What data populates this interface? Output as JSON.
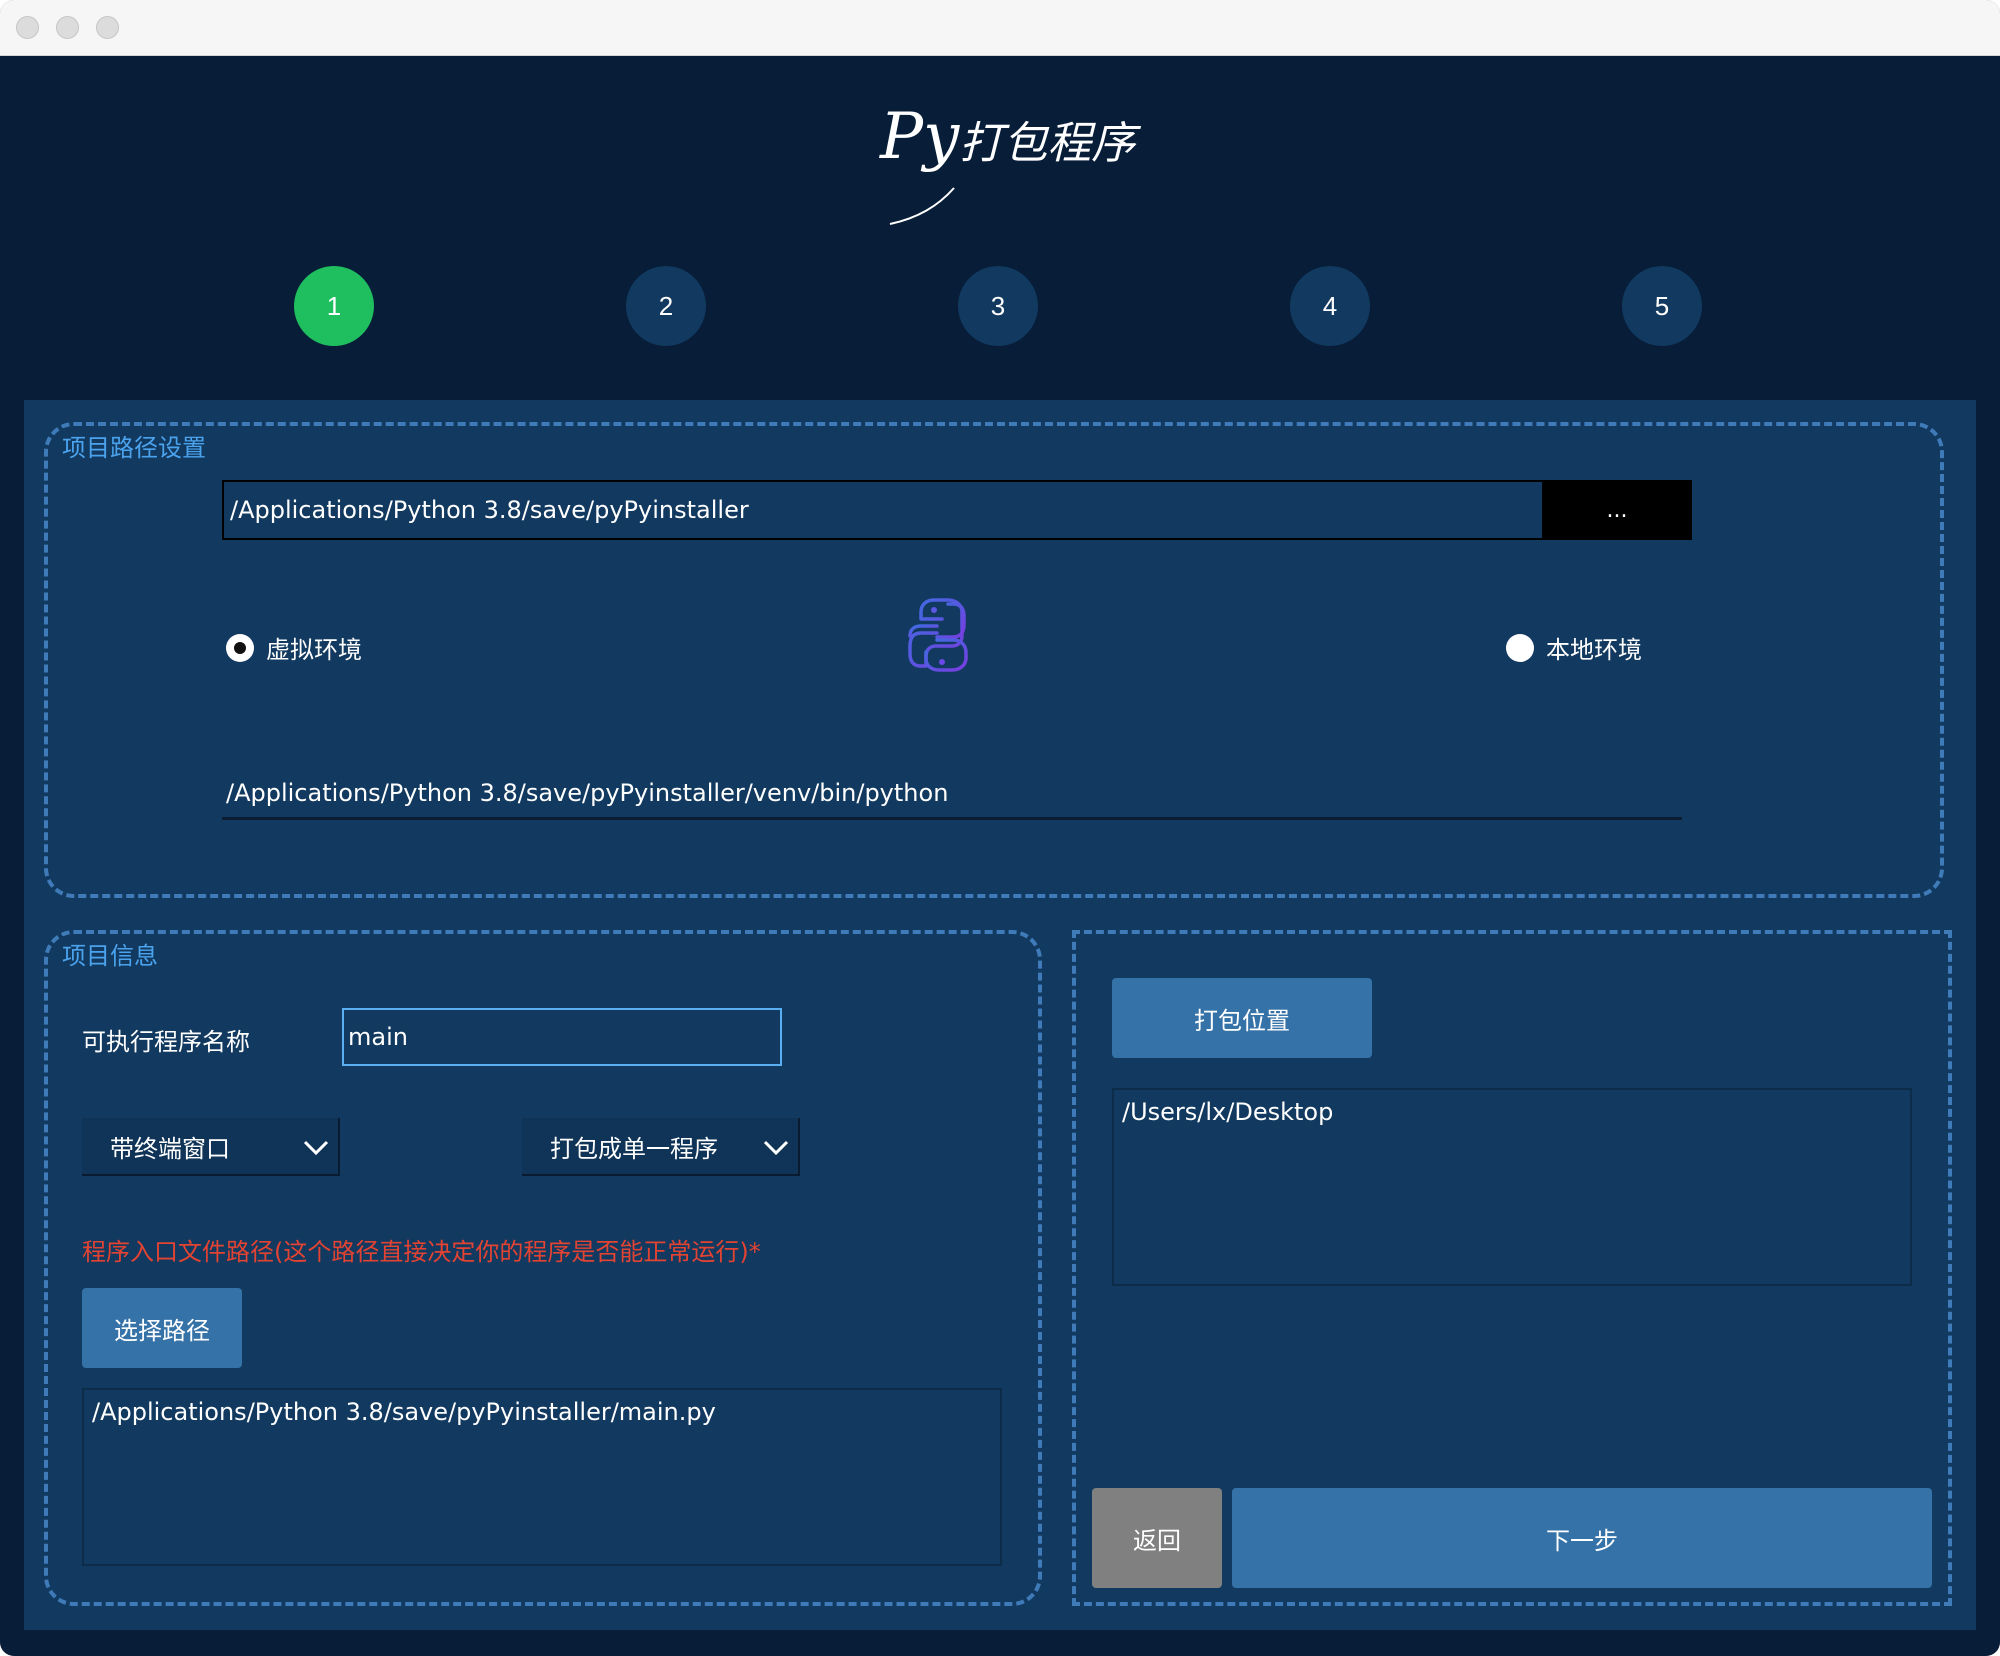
{
  "app": {
    "title_script": "Py",
    "title_rest": "打包程序"
  },
  "steps": [
    {
      "label": "1"
    },
    {
      "label": "2"
    },
    {
      "label": "3"
    },
    {
      "label": "4"
    },
    {
      "label": "5"
    }
  ],
  "project_path": {
    "group_label": "项目路径设置",
    "path_value": "/Applications/Python 3.8/save/pyPyinstaller",
    "browse_label": "...",
    "radio_virtual": "虚拟环境",
    "radio_local": "本地环境",
    "selected_env": "虚拟环境",
    "interpreter_path": "/Applications/Python 3.8/save/pyPyinstaller/venv/bin/python"
  },
  "project_info": {
    "group_label": "项目信息",
    "exe_name_label": "可执行程序名称",
    "exe_name_value": "main",
    "console_select": "带终端窗口",
    "bundle_select": "打包成单一程序",
    "entry_warning": "程序入口文件路径(这个路径直接决定你的程序是否能正常运行)*",
    "choose_path_label": "选择路径",
    "entry_path": "/Applications/Python 3.8/save/pyPyinstaller/main.py"
  },
  "output": {
    "location_button": "打包位置",
    "location_path": "/Users/lx/Desktop",
    "back_button": "返回",
    "next_button": "下一步"
  },
  "colors": {
    "background": "#071d38",
    "panel": "#12395f",
    "active_step": "#1fbf5f",
    "button": "#3572a8",
    "warning": "#e24332",
    "group_label": "#4ba3ee"
  },
  "icons": [
    "python-logo-icon",
    "chevron-down-icon"
  ]
}
